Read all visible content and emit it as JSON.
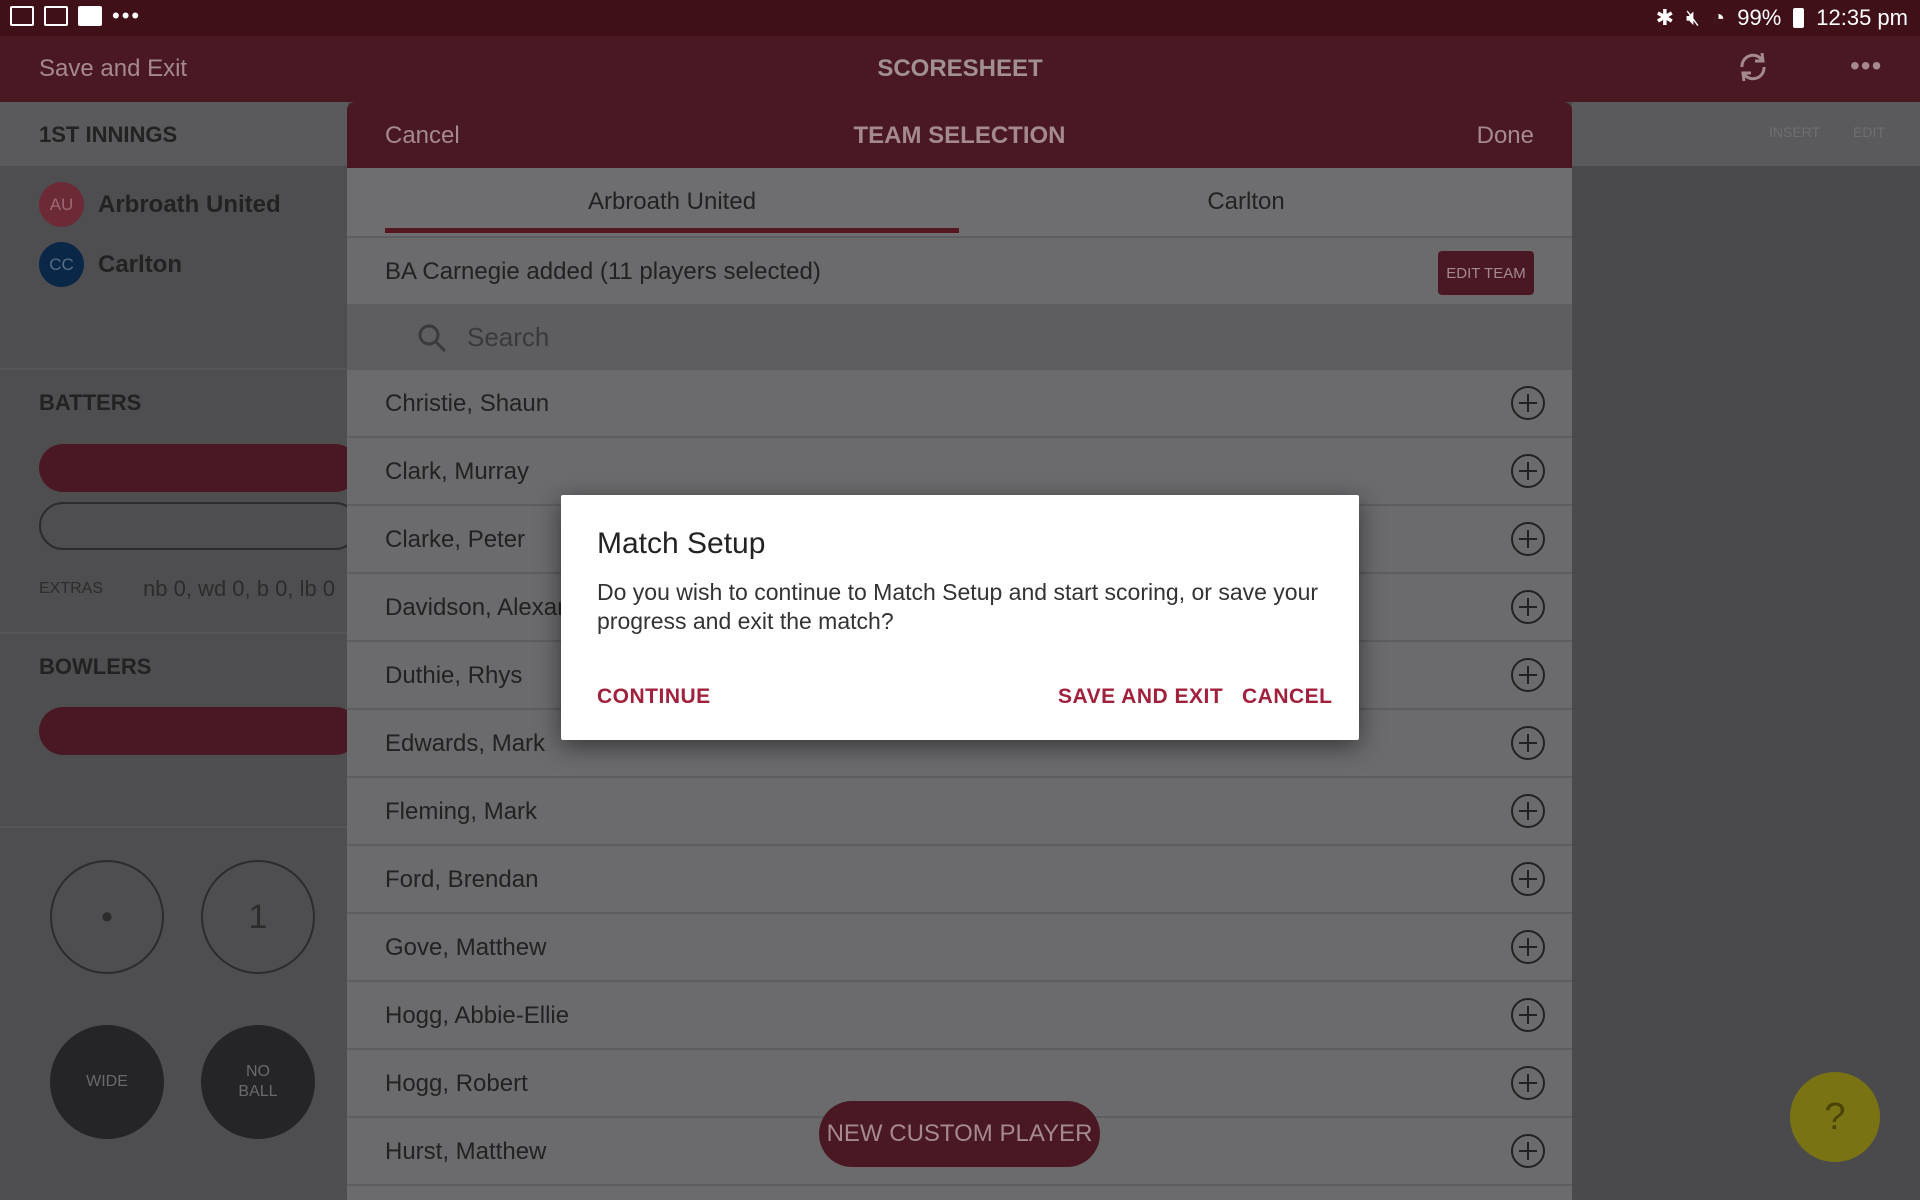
{
  "status_bar": {
    "battery": "99%",
    "time": "12:35 pm",
    "overflow_dots": "•••"
  },
  "app_bar": {
    "left_action": "Save and Exit",
    "title": "SCORESHEET",
    "more": "•••"
  },
  "left_panel": {
    "innings_title": "1ST INNINGS",
    "teams": [
      {
        "initials": "AU",
        "name": "Arbroath United",
        "color": "#6b2a36"
      },
      {
        "initials": "CC",
        "name": "Carlton",
        "color": "#0a2747"
      }
    ],
    "batters_title": "BATTERS",
    "extras_label": "EXTRAS",
    "extras_value": "nb 0, wd 0, b 0, lb 0",
    "bowlers_title": "BOWLERS",
    "ball_dot": "•",
    "ball_one": "1",
    "wide_label": "WIDE",
    "no_ball_label": "NO\nBALL"
  },
  "right_panel": {
    "insert": "INSERT",
    "edit": "EDIT",
    "help": "?"
  },
  "team_selection": {
    "cancel": "Cancel",
    "title": "TEAM SELECTION",
    "done": "Done",
    "tabs": [
      "Arbroath United",
      "Carlton"
    ],
    "active_tab": 0,
    "status_text": "BA Carnegie added (11 players selected)",
    "edit_team": "EDIT TEAM",
    "search_placeholder": "Search",
    "players": [
      "Christie, Shaun",
      "Clark, Murray",
      "Clarke, Peter",
      "Davidson, Alexander",
      "Duthie, Rhys",
      "Edwards, Mark",
      "Fleming, Mark",
      "Ford, Brendan",
      "Gove, Matthew",
      "Hogg, Abbie-Ellie",
      "Hogg, Robert",
      "Hurst, Matthew"
    ],
    "new_custom_player": "NEW CUSTOM PLAYER"
  },
  "dialog": {
    "title": "Match Setup",
    "message": "Do you wish to continue to Match Setup and start scoring, or save your progress and exit the match?",
    "continue": "CONTINUE",
    "save_and_exit": "SAVE AND EXIT",
    "cancel": "CANCEL"
  },
  "colors": {
    "brand_maroon": "#a1203c",
    "dialog_button": "#a1203c",
    "help_yellow": "#f2e52a"
  }
}
